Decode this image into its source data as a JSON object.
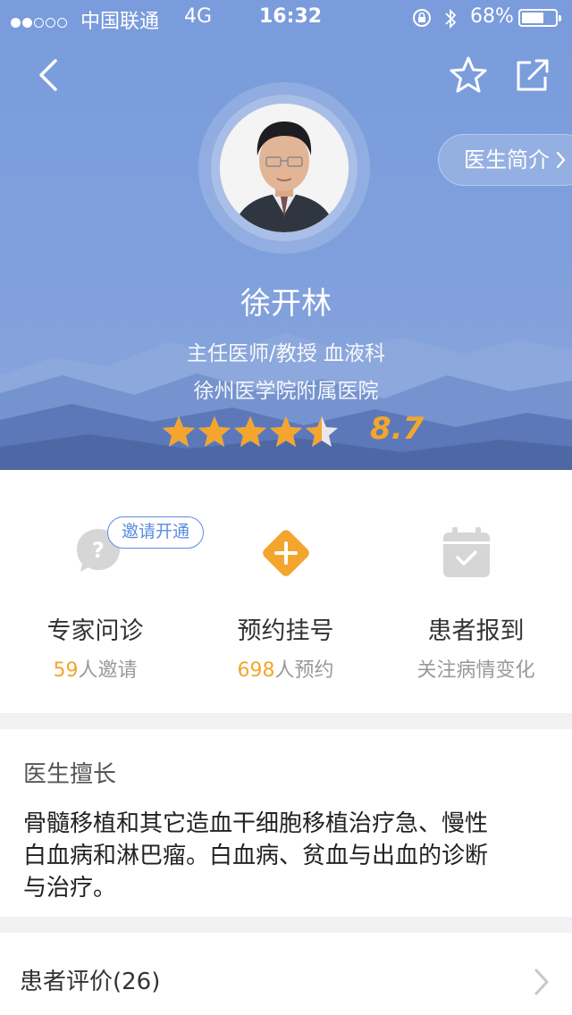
{
  "status_bar": {
    "signal_dots_filled": 2,
    "signal_dots_total": 5,
    "carrier": "中国联通",
    "network": "4G",
    "time": "16:32",
    "battery_percent": "68%",
    "battery_level": 0.68
  },
  "header": {
    "back_icon": "chevron-left-icon",
    "favorite_icon": "star-outline-icon",
    "share_icon": "share-icon"
  },
  "doctor": {
    "intro_button": "医生简介",
    "name": "徐开林",
    "title": "主任医师/教授 血液科",
    "hospital": "徐州医学院附属医院",
    "rating_stars": 4.5,
    "rating_max": 5,
    "score": "8.7"
  },
  "services": [
    {
      "label": "专家问诊",
      "count": "59",
      "suffix": "人邀请",
      "badge": "邀请开通",
      "icon": "question-bubble-icon"
    },
    {
      "label": "预约挂号",
      "count": "698",
      "suffix": "人预约",
      "icon": "plus-diamond-icon"
    },
    {
      "label": "患者报到",
      "count": "",
      "suffix": "关注病情变化",
      "icon": "calendar-check-icon"
    }
  ],
  "specialty": {
    "heading": "医生擅长",
    "lines": [
      "骨髓移植和其它造血干细胞移植治疗急、慢性",
      "白血病和淋巴瘤。白血病、贫血与出血的诊断",
      "与治疗。"
    ]
  },
  "reviews": {
    "label": "患者评价(26)"
  },
  "colors": {
    "header_blue": "#7f9fdc",
    "accent_orange": "#f3a52e",
    "link_blue": "#5b8be0"
  }
}
